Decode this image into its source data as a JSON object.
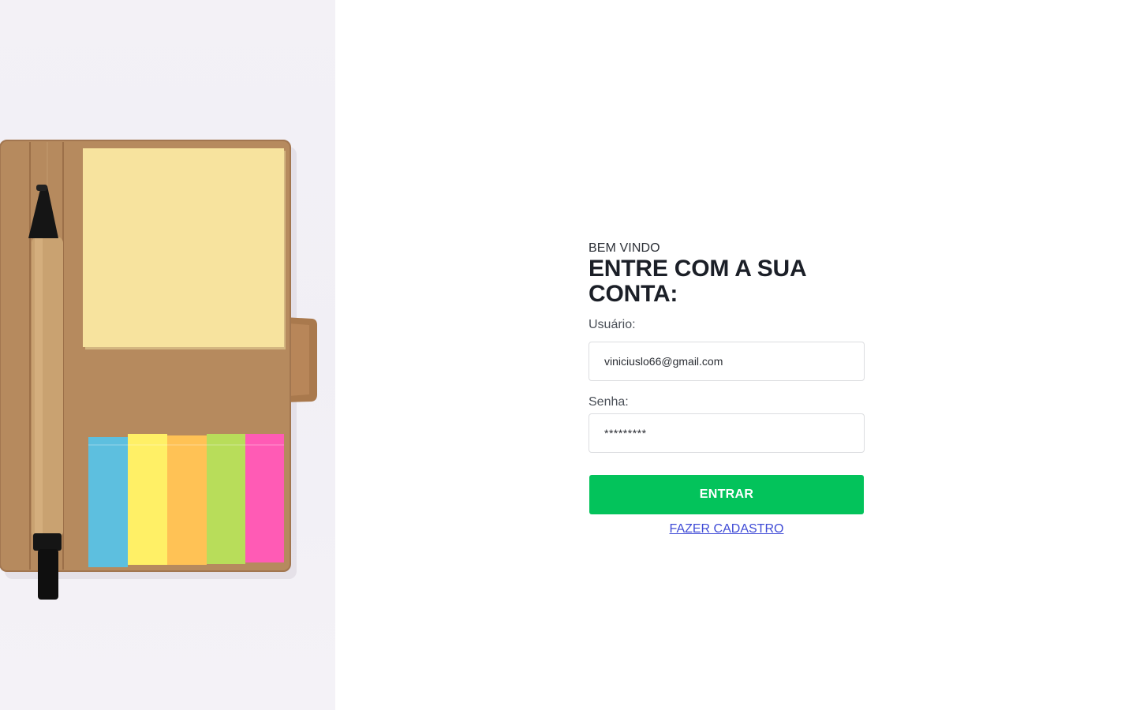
{
  "login": {
    "greeting": "BEM VINDO",
    "title": "ENTRE COM A SUA CONTA:",
    "user_label": "Usuário:",
    "user_value": "viniciuslo66@gmail.com",
    "password_label": "Senha:",
    "password_value": "*********",
    "submit_label": "ENTRAR",
    "register_label": "FAZER CADASTRO"
  },
  "colors": {
    "accent": "#03c35b",
    "link": "#3f4bd6",
    "title": "#1b1f27"
  },
  "illustration": {
    "subject": "kraft notebook with sticky notes and pen",
    "icon": "notebook-photo"
  }
}
